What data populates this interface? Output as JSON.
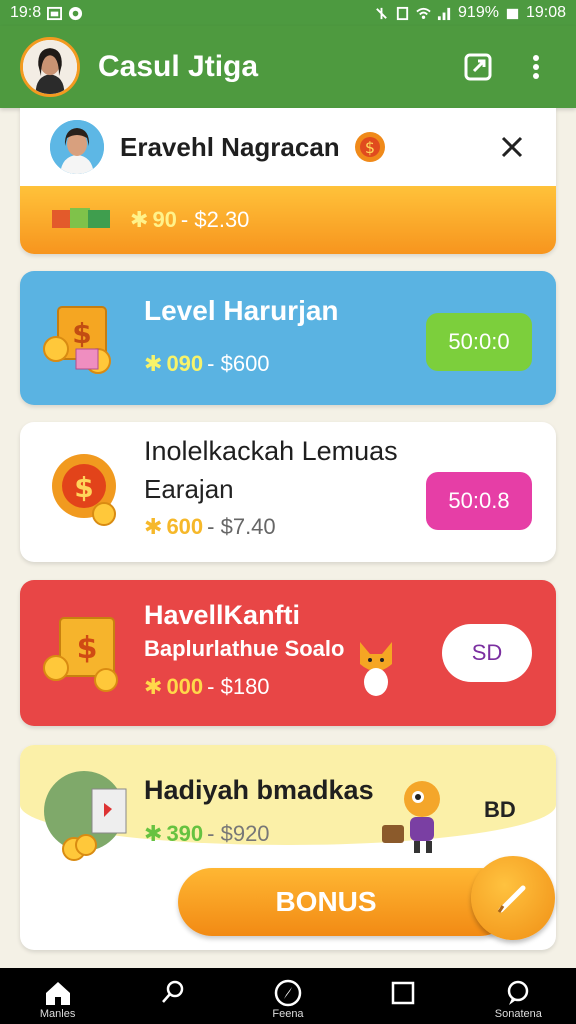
{
  "status_bar": {
    "time_left": "19:8",
    "battery": "919%",
    "time_right": "19:08"
  },
  "app_bar": {
    "title": "Casul Jtiga",
    "icons": [
      "avatar-icon",
      "share-icon",
      "more-vert-icon"
    ]
  },
  "cards": [
    {
      "title": "Eravehl Nagracan",
      "range_a": "90",
      "range_b": "- $2.30"
    },
    {
      "title": "Level Harurjan",
      "range_a": "090",
      "range_b": "- $600",
      "button": "50:0:0"
    },
    {
      "title": "Inolelkackah Lemuas",
      "subtitle": "Earajan",
      "range_a": "600",
      "range_b": "- $7.40",
      "button": "50:0.8"
    },
    {
      "title": "HavellKanfti",
      "subtitle": "Baplurlathue Soalo",
      "range_a": "000",
      "range_b": "- $180",
      "button": "SD"
    },
    {
      "title": "Hadiyah bmadkas",
      "range_a": "390",
      "range_b": "- $920",
      "side_text": "BD"
    }
  ],
  "bonus_label": "BONUS",
  "nav": [
    {
      "label": "Manles",
      "icon": "home-icon"
    },
    {
      "label": "",
      "icon": "search-icon"
    },
    {
      "label": "Feena",
      "icon": "compass-icon"
    },
    {
      "label": "",
      "icon": "square-icon"
    },
    {
      "label": "Sonatena",
      "icon": "chat-icon"
    }
  ],
  "colors": {
    "primary": "#4e9a3f",
    "orange": "#f7951e",
    "blue": "#5ab3e2",
    "red": "#e84646",
    "green_btn": "#7ccf3c",
    "pink_btn": "#e63ea6"
  }
}
